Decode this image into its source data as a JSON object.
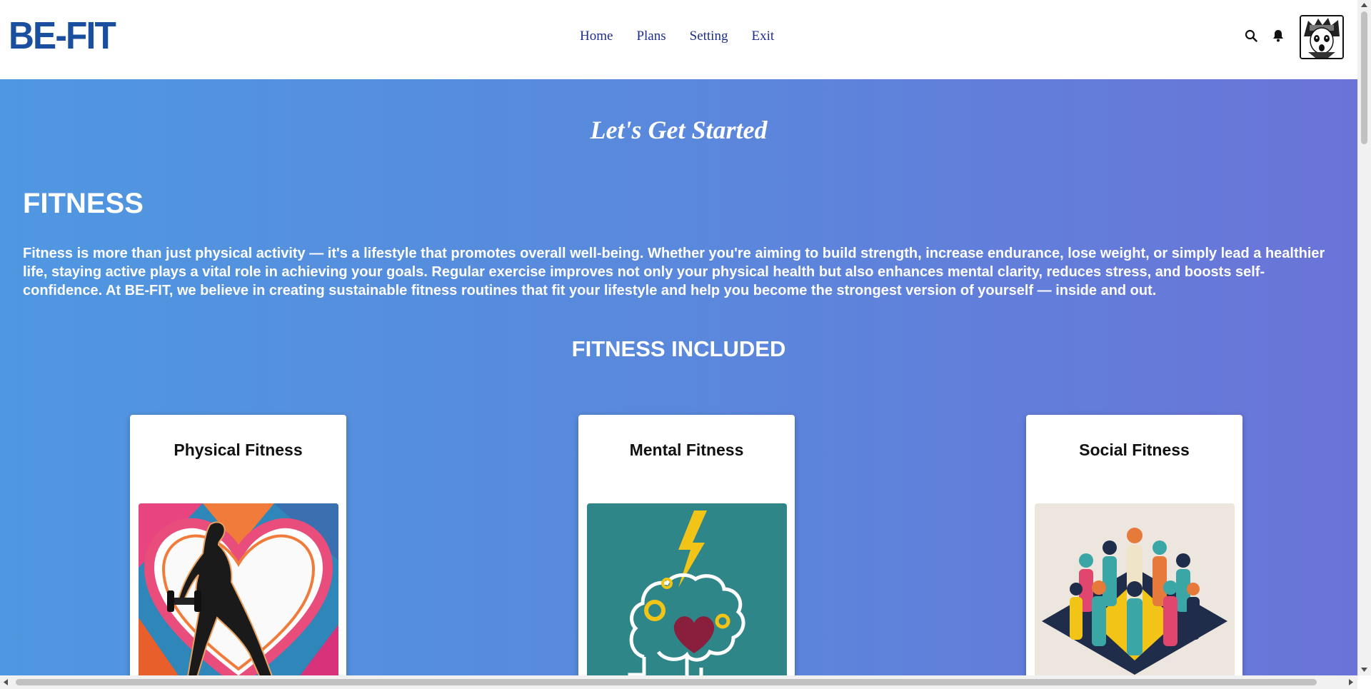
{
  "header": {
    "logo": "BE-FIT",
    "nav": [
      "Home",
      "Plans",
      "Setting",
      "Exit"
    ]
  },
  "hero": {
    "tagline": "Let's Get Started",
    "title": "FITNESS",
    "intro": "Fitness is more than just physical activity — it's a lifestyle that promotes overall well-being. Whether you're aiming to build strength, increase endurance, lose weight, or simply lead a healthier life, staying active plays a vital role in achieving your goals. Regular exercise improves not only your physical health but also enhances mental clarity, reduces stress, and boosts self-confidence. At BE-FIT, we believe in creating sustainable fitness routines that fit your lifestyle and help you become the strongest version of yourself — inside and out.",
    "included_title": "FITNESS INCLUDED"
  },
  "cards": [
    {
      "title": "Physical Fitness"
    },
    {
      "title": "Mental Fitness"
    },
    {
      "title": "Social Fitness"
    }
  ],
  "colors": {
    "logo": "#1a4fa0",
    "nav": "#1e2d8f",
    "gradient_start": "#4f97e0",
    "gradient_end": "#6a74d8"
  }
}
